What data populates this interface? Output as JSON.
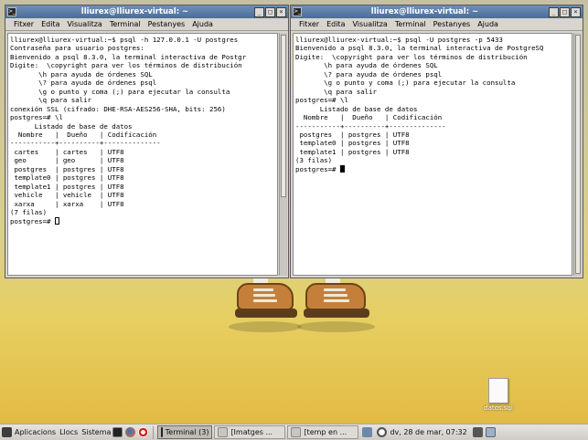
{
  "windows": [
    {
      "title": "lliurex@lliurex-virtual: ~",
      "menu": [
        "Fitxer",
        "Edita",
        "Visualitza",
        "Terminal",
        "Pestanyes",
        "Ajuda"
      ],
      "lines": [
        "lliurex@lliurex-virtual:~$ psql -h 127.0.0.1 -U postgres",
        "Contraseña para usuario postgres:",
        "Bienvenido a psql 8.3.0, la terminal interactiva de Postgr",
        "",
        "Digite:  \\copyright para ver los términos de distribución",
        "       \\h para ayuda de órdenes SQL",
        "       \\? para ayuda de órdenes psql",
        "       \\g o punto y coma (;) para ejecutar la consulta",
        "       \\q para salir",
        "",
        "conexión SSL (cifrado: DHE-RSA-AES256-SHA, bits: 256)",
        "postgres=# \\l",
        "      Listado de base de datos",
        "  Nombre   |  Dueño   | Codificación",
        "-----------+----------+--------------",
        " cartes    | cartes   | UTF8",
        " geo       | geo      | UTF8",
        " postgres  | postgres | UTF8",
        " template0 | postgres | UTF8",
        " template1 | postgres | UTF8",
        " vehicle   | vehicle  | UTF8",
        " xarxa     | xarxa    | UTF8",
        "(7 filas)",
        ""
      ],
      "prompt": "postgres=# "
    },
    {
      "title": "lliurex@lliurex-virtual: ~",
      "menu": [
        "Fitxer",
        "Edita",
        "Visualitza",
        "Terminal",
        "Pestanyes",
        "Ajuda"
      ],
      "lines": [
        "lliurex@lliurex-virtual:~$ psql -U postgres -p 5433",
        "Bienvenido a psql 8.3.0, la terminal interactiva de PostgreSQ",
        "",
        "Digite:  \\copyright para ver los términos de distribución",
        "       \\h para ayuda de órdenes SQL",
        "       \\? para ayuda de órdenes psql",
        "       \\g o punto y coma (;) para ejecutar la consulta",
        "       \\q para salir",
        "",
        "postgres=# \\l",
        "      Listado de base de datos",
        "  Nombre   |  Dueño   | Codificación",
        "-----------+----------+--------------",
        " postgres  | postgres | UTF8",
        " template0 | postgres | UTF8",
        " template1 | postgres | UTF8",
        "(3 filas)",
        ""
      ],
      "prompt": "postgres=# "
    }
  ],
  "desktop_icon": {
    "label": "datos.sql"
  },
  "taskbar": {
    "applications": "Aplicacions",
    "places": "Llocs",
    "system": "Sistema",
    "tasks": [
      "Terminal (3)",
      "[Imatges ...",
      "[temp en ..."
    ],
    "clock": "dv, 28 de mar, 07:32"
  },
  "colors": {
    "titlebar": "#4a6d99",
    "terminal_bg": "#ffffff",
    "wallpaper_yellow": "#e2bb44"
  }
}
